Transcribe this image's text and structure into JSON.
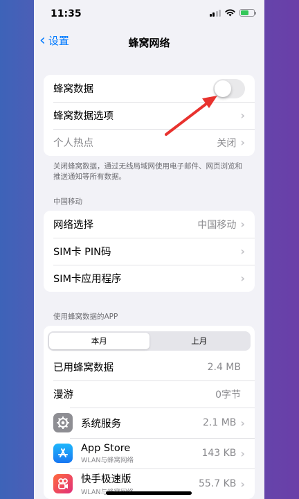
{
  "status": {
    "time": "11:35"
  },
  "nav": {
    "back_label": "设置",
    "title": "蜂窝网络"
  },
  "group1": {
    "cellular_data": "蜂窝数据",
    "cellular_options": "蜂窝数据选项",
    "hotspot": "个人热点",
    "hotspot_value": "关闭"
  },
  "footnote": "关闭蜂窝数据，通过无线局域网使用电子邮件、网页浏览和推送通知等所有数据。",
  "carrier": {
    "header": "中国移动",
    "network_select": "网络选择",
    "network_value": "中国移动",
    "sim_pin": "SIM卡 PIN码",
    "sim_apps": "SIM卡应用程序"
  },
  "usage": {
    "header": "使用蜂窝数据的APP",
    "seg_current": "本月",
    "seg_last": "上月",
    "used_label": "已用蜂窝数据",
    "used_value": "2.4 MB",
    "roaming_label": "漫游",
    "roaming_value": "0字节"
  },
  "apps": [
    {
      "name": "系统服务",
      "sub": "",
      "value": "2.1 MB",
      "icon": "gear-icon"
    },
    {
      "name": "App Store",
      "sub": "WLAN与蜂窝网络",
      "value": "143 KB",
      "icon": "app-store-icon"
    },
    {
      "name": "快手极速版",
      "sub": "WLAN与蜂窝网络",
      "value": "55.7 KB",
      "icon": "kuaishou-icon"
    }
  ],
  "colors": {
    "accent": "#007aff",
    "arrow": "#e8322e",
    "toggle_off": "#e9e9eb"
  },
  "toggle_state": {
    "cellular_data_on": false
  }
}
